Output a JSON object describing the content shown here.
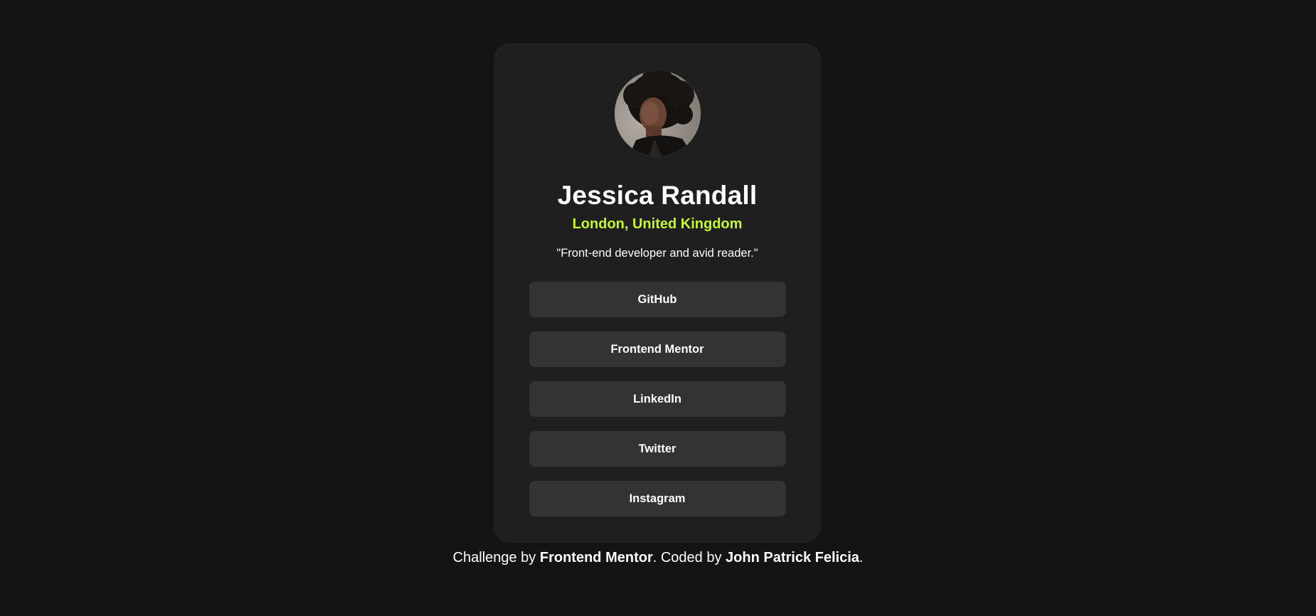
{
  "colors": {
    "page_background": "#141414",
    "card_background": "#1f1f1f",
    "button_background": "#333333",
    "accent": "#c4f82a",
    "text": "#ffffff"
  },
  "profile": {
    "avatar_alt": "avatar-photo",
    "name": "Jessica Randall",
    "location": "London, United Kingdom",
    "bio": "\"Front-end developer and avid reader.\""
  },
  "links": [
    {
      "label": "GitHub"
    },
    {
      "label": "Frontend Mentor"
    },
    {
      "label": "LinkedIn"
    },
    {
      "label": "Twitter"
    },
    {
      "label": "Instagram"
    }
  ],
  "attribution": {
    "prefix": "Challenge by ",
    "challenge_link": "Frontend Mentor",
    "middle": ". Coded by ",
    "author_link": "John Patrick Felicia",
    "suffix": "."
  }
}
